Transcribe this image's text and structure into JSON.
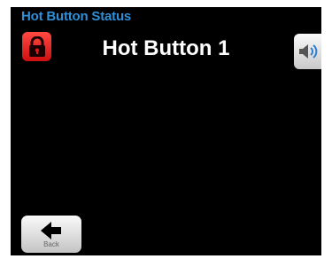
{
  "header": {
    "title": "Hot Button Status"
  },
  "main": {
    "title": "Hot Button 1"
  },
  "controls": {
    "lock_icon": "lock-icon",
    "speaker_icon": "speaker-icon",
    "back_icon": "arrow-left-icon",
    "back_label": "Back"
  },
  "colors": {
    "background": "#000000",
    "header_text": "#2f8fd8",
    "title_text": "#ffffff",
    "lock_button": "#e3181a",
    "speaker_button": "#e6e6e6",
    "speaker_icon": "#2a7fd0",
    "back_button": "#e6e6e6"
  }
}
